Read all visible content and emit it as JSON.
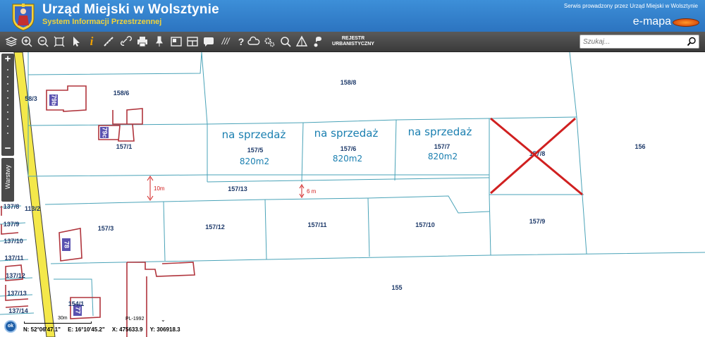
{
  "header": {
    "title": "Urząd Miejski w Wolsztynie",
    "subtitle": "System Informacji Przestrzennej",
    "service_note": "Serwis prowadzony przez Urząd Miejski w Wolsztynie",
    "brand": "e-mapa"
  },
  "toolbar": {
    "registry_label_1": "REJESTR",
    "registry_label_2": "URBANISTYCZNY",
    "icons": [
      "layers-icon",
      "zoom-in-icon",
      "zoom-out-icon",
      "zoom-extent-icon",
      "pointer-icon",
      "info-icon",
      "measure-icon",
      "link-icon",
      "print-icon",
      "pin-icon",
      "layout-icon",
      "table-icon",
      "comment-icon",
      "hatch-icon",
      "help-icon",
      "cloud-icon",
      "settings-icon",
      "search-map-icon",
      "triangle-icon",
      "note-icon"
    ]
  },
  "search": {
    "placeholder": "Szukaj..."
  },
  "sidebar": {
    "zoom_plus": "+",
    "zoom_minus": "−",
    "layers_label": "Warstwy"
  },
  "map": {
    "parcels": [
      "58/3",
      "158/6",
      "158/8",
      "157/1",
      "157/5",
      "157/6",
      "157/7",
      "157/8",
      "156",
      "157/13",
      "157/3",
      "157/12",
      "157/11",
      "157/10",
      "157/9",
      "155",
      "154/1",
      "113/2",
      "137/8",
      "137/9",
      "137/10",
      "137/11",
      "137/12",
      "137/13",
      "137/14"
    ],
    "buildings": [
      "79b",
      "79c",
      "78",
      "77"
    ],
    "sale_label": "na sprzedaż",
    "area_label": "820m2",
    "dim_10m": "10m",
    "dim_6m": "6 m"
  },
  "footer": {
    "ok": "ok",
    "scale": "30m",
    "crs": "PL-1992",
    "lat": "N: 52°06'47.1\"",
    "lon": "E: 16°10'45.2\"",
    "x": "X: 475633.9",
    "y": "Y: 306918.3"
  },
  "colors": {
    "header": "#2c74c0",
    "parcel_line": "#4aa3b8",
    "building": "#b0343c",
    "sale_text": "#1a7fb0",
    "road": "#f4e84a",
    "annotation": "#d02020"
  }
}
